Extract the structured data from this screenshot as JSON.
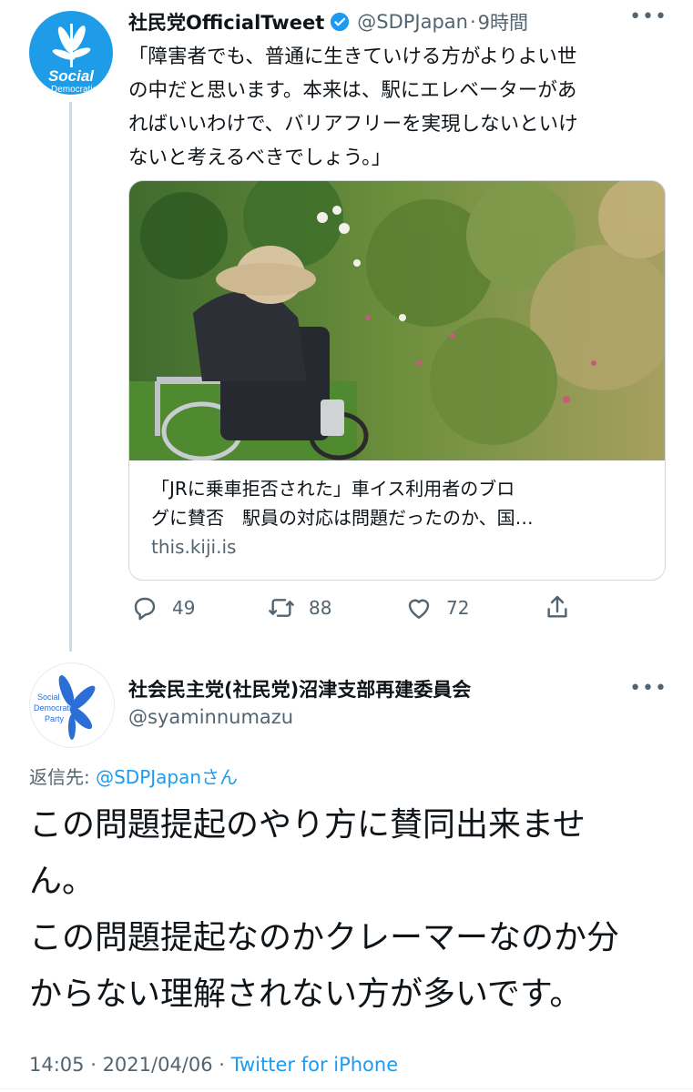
{
  "tweet": {
    "author_name": "社民党OfficialTweet",
    "handle": "@SDPJapan",
    "separator": "·",
    "time": "9時間",
    "avatar_text": "Social",
    "avatar_subtext": "Democratic P",
    "text": "「障害者でも、普通に生きていける方がよりよい世\nの中だと思います。本来は、駅にエレベーターがあ\nればいいわけで、バリアフリーを実現しないといけ\nないと考えるべきでしょう。」",
    "card": {
      "title": "「JRに乗車拒否された」車イス利用者のブロ\nグに賛否　駅員の対応は問題だったのか、国…",
      "domain": "this.kiji.is"
    },
    "actions": {
      "replies": "49",
      "retweets": "88",
      "likes": "72"
    },
    "icons": {
      "verified": "verified-badge-icon",
      "more": "more-icon",
      "reply": "reply-icon",
      "retweet": "retweet-icon",
      "like": "heart-icon",
      "share": "share-icon"
    }
  },
  "reply": {
    "author_name": "社会民主党(社民党)沼津支部再建委員会",
    "handle": "@syaminnumazu",
    "avatar_text": "Social\nDemocratic\nParty",
    "replying_to_prefix": "返信先: ",
    "replying_to_handle": "@SDPJapan",
    "replying_to_suffix": "さん",
    "text": "この問題提起のやり方に賛同出来ませ\nん。\nこの問題提起なのかクレーマーなのか分\nからない理解されない方が多いです。",
    "time": "14:05",
    "separator1": " · ",
    "date": "2021/04/06",
    "separator2": " · ",
    "source": "Twitter for iPhone"
  },
  "more_glyph": "•••",
  "colors": {
    "brand_blue": "#1d9bf0",
    "avatar_blue": "#1f9ce8",
    "text_primary": "#0f1419",
    "text_secondary": "#536471",
    "border": "#cfd9de"
  }
}
